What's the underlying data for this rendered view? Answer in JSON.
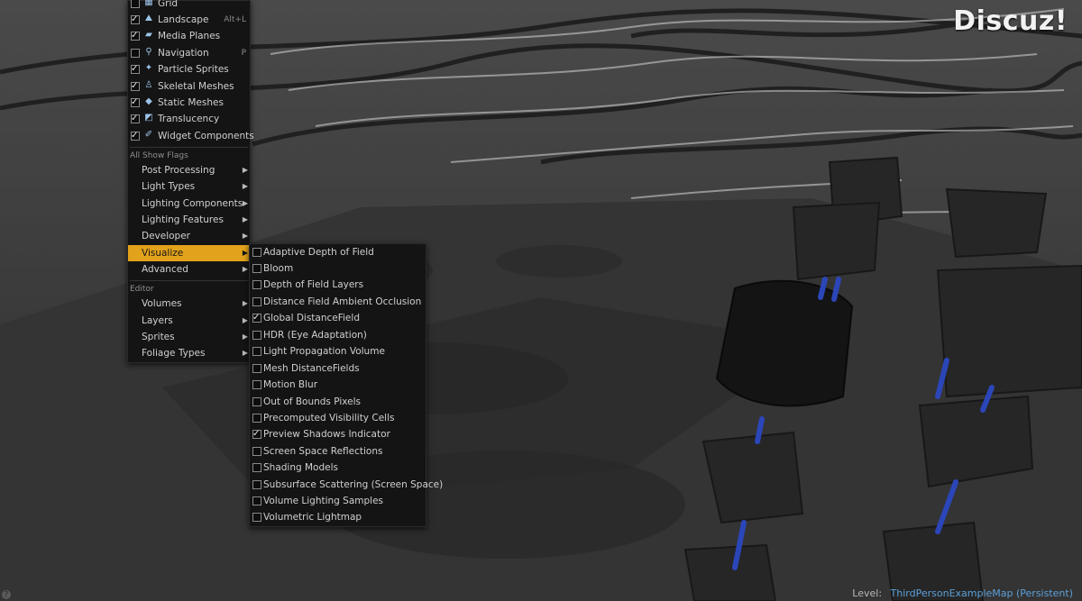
{
  "watermark": "Discuz!",
  "status": {
    "level_label": "Level:",
    "level_value": "ThirdPersonExampleMap (Persistent)"
  },
  "colors": {
    "menu_bg": "#141414",
    "highlight": "#e2a21b",
    "level_value": "#5ca0d8"
  },
  "main_menu": {
    "flags": [
      {
        "label": "Grid",
        "checked": false,
        "icon": "grid-icon",
        "shortcut": ""
      },
      {
        "label": "Landscape",
        "checked": true,
        "icon": "landscape-icon",
        "shortcut": "Alt+L"
      },
      {
        "label": "Media Planes",
        "checked": true,
        "icon": "media-planes-icon",
        "shortcut": ""
      },
      {
        "label": "Navigation",
        "checked": false,
        "icon": "navigation-icon",
        "shortcut": "P"
      },
      {
        "label": "Particle Sprites",
        "checked": true,
        "icon": "particle-sprites-icon",
        "shortcut": ""
      },
      {
        "label": "Skeletal Meshes",
        "checked": true,
        "icon": "skeletal-meshes-icon",
        "shortcut": ""
      },
      {
        "label": "Static Meshes",
        "checked": true,
        "icon": "static-meshes-icon",
        "shortcut": ""
      },
      {
        "label": "Translucency",
        "checked": true,
        "icon": "translucency-icon",
        "shortcut": ""
      },
      {
        "label": "Widget Components",
        "checked": true,
        "icon": "widget-components-icon",
        "shortcut": ""
      }
    ],
    "all_show_flags_header": "All Show Flags",
    "all_show_flags": [
      {
        "label": "Post Processing"
      },
      {
        "label": "Light Types"
      },
      {
        "label": "Lighting Components"
      },
      {
        "label": "Lighting Features"
      },
      {
        "label": "Developer"
      },
      {
        "label": "Visualize",
        "active": true
      },
      {
        "label": "Advanced"
      }
    ],
    "editor_header": "Editor",
    "editor_items": [
      {
        "label": "Volumes"
      },
      {
        "label": "Layers"
      },
      {
        "label": "Sprites"
      },
      {
        "label": "Foliage Types"
      }
    ]
  },
  "visualize_menu": {
    "items": [
      {
        "label": "Adaptive Depth of Field",
        "checked": false
      },
      {
        "label": "Bloom",
        "checked": false
      },
      {
        "label": "Depth of Field Layers",
        "checked": false
      },
      {
        "label": "Distance Field Ambient Occlusion",
        "checked": false
      },
      {
        "label": "Global DistanceField",
        "checked": true
      },
      {
        "label": "HDR (Eye Adaptation)",
        "checked": false
      },
      {
        "label": "Light Propagation Volume",
        "checked": false
      },
      {
        "label": "Mesh DistanceFields",
        "checked": false
      },
      {
        "label": "Motion Blur",
        "checked": false
      },
      {
        "label": "Out of Bounds Pixels",
        "checked": false
      },
      {
        "label": "Precomputed Visibility Cells",
        "checked": false
      },
      {
        "label": "Preview Shadows Indicator",
        "checked": true
      },
      {
        "label": "Screen Space Reflections",
        "checked": false
      },
      {
        "label": "Shading Models",
        "checked": false
      },
      {
        "label": "Subsurface Scattering (Screen Space)",
        "checked": false
      },
      {
        "label": "Volume Lighting Samples",
        "checked": false
      },
      {
        "label": "Volumetric Lightmap",
        "checked": false
      }
    ]
  }
}
